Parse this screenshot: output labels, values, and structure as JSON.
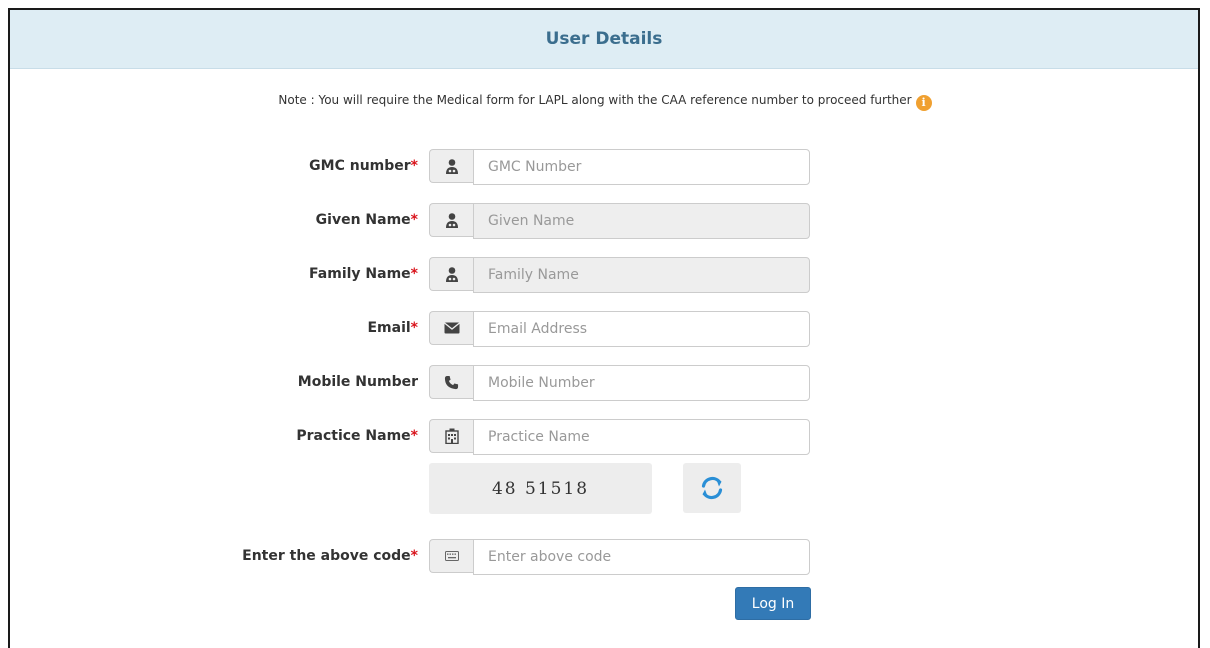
{
  "header": {
    "title": "User Details"
  },
  "note": {
    "text": "Note : You will require the Medical form for LAPL along with the CAA reference number to proceed further",
    "icon": "info-icon",
    "icon_glyph": "i"
  },
  "colors": {
    "header_bg": "#deedf4",
    "header_text": "#3b6e8e",
    "required": "#d9141c",
    "button": "#337ab7",
    "info": "#f0a030"
  },
  "fields": [
    {
      "label": "GMC number",
      "required": "*",
      "icon": "user-md-icon",
      "placeholder": "GMC Number",
      "value": ""
    },
    {
      "label": "Given Name",
      "required": "*",
      "icon": "user-md-icon",
      "placeholder": "Given Name",
      "value": ""
    },
    {
      "label": "Family Name",
      "required": "*",
      "icon": "user-md-icon",
      "placeholder": "Family Name",
      "value": ""
    },
    {
      "label": "Email",
      "required": "*",
      "icon": "envelope-icon",
      "placeholder": "Email Address",
      "value": ""
    },
    {
      "label": "Mobile Number",
      "required": "",
      "icon": "phone-icon",
      "placeholder": "Mobile Number",
      "value": ""
    },
    {
      "label": "Practice Name",
      "required": "*",
      "icon": "hospital-icon",
      "placeholder": "Practice Name",
      "value": ""
    }
  ],
  "captcha": {
    "code": "48 51518",
    "refresh_icon": "refresh-icon"
  },
  "code_field": {
    "label": "Enter the above code",
    "required": "*",
    "icon": "keyboard-icon",
    "placeholder": "Enter above code",
    "value": ""
  },
  "login_button": {
    "label": "Log In"
  }
}
